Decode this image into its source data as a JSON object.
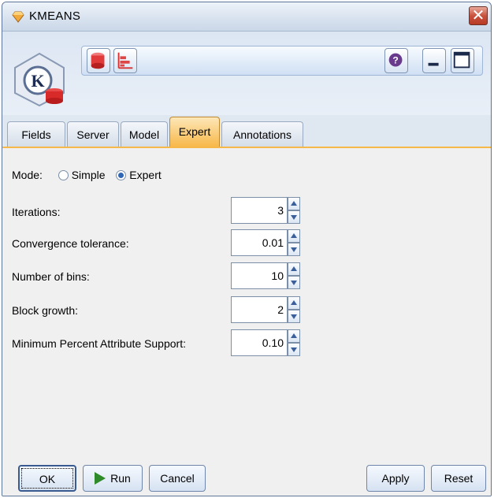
{
  "window": {
    "title": "KMEANS",
    "close_glyph": "✕"
  },
  "toolbar": {
    "left_icons": [
      "database-icon",
      "chart-icon"
    ],
    "right_icons": [
      "help-icon",
      "minimize-icon",
      "maximize-icon"
    ],
    "help_glyph": "?"
  },
  "node_icon": {
    "name": "kmeans-node-icon",
    "letter": "K"
  },
  "tabs": [
    {
      "label": "Fields",
      "active": false
    },
    {
      "label": "Server",
      "active": false
    },
    {
      "label": "Model",
      "active": false
    },
    {
      "label": "Expert",
      "active": true
    },
    {
      "label": "Annotations",
      "active": false
    }
  ],
  "mode": {
    "label": "Mode:",
    "options": [
      {
        "label": "Simple",
        "checked": false
      },
      {
        "label": "Expert",
        "checked": true
      }
    ]
  },
  "fields": [
    {
      "label": "Iterations:",
      "value": "3"
    },
    {
      "label": "Convergence tolerance:",
      "value": "0.01"
    },
    {
      "label": "Number of bins:",
      "value": "10"
    },
    {
      "label": "Block growth:",
      "value": "2"
    },
    {
      "label": "Minimum Percent Attribute Support:",
      "value": "0.10"
    }
  ],
  "buttons": {
    "ok": "OK",
    "run": "Run",
    "cancel": "Cancel",
    "apply": "Apply",
    "reset": "Reset"
  },
  "colors": {
    "active_tab": "#f7b84a",
    "header_bg": "#dce6f3",
    "run_icon": "#2f8a2a",
    "close_button": "#c9523d"
  }
}
